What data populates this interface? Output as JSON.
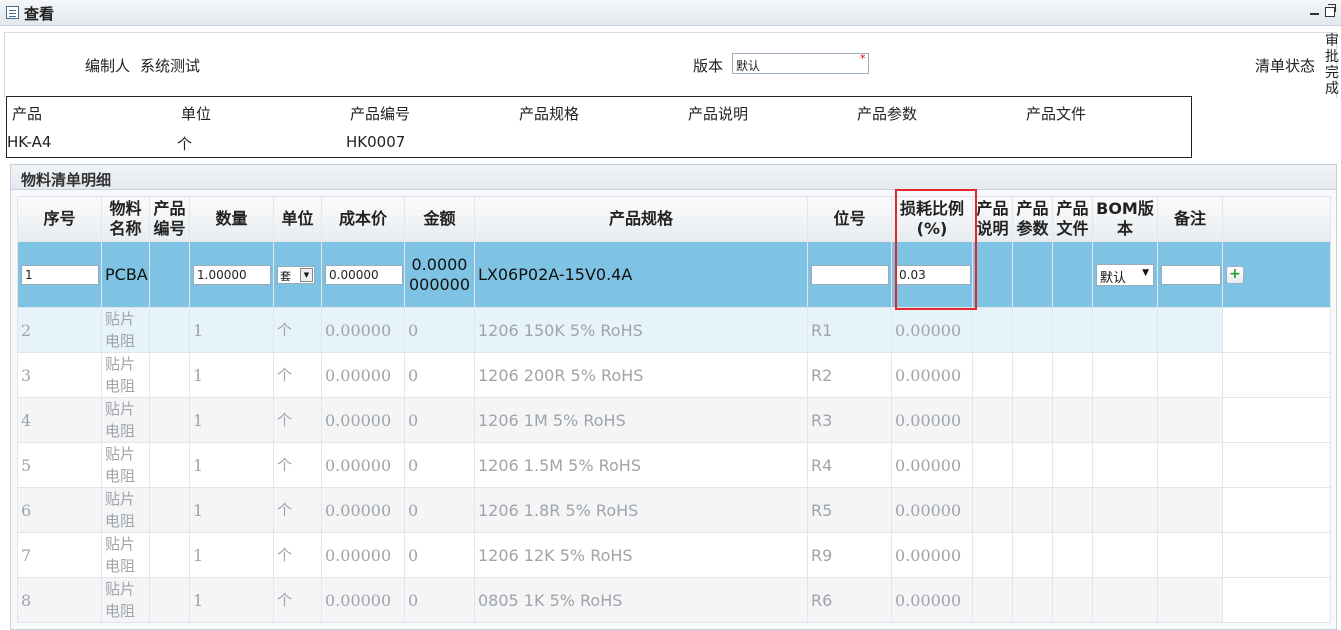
{
  "window": {
    "title": "查看"
  },
  "header": {
    "author_label": "编制人",
    "author_value": "系统测试",
    "version_label": "版本",
    "version_value": "默认",
    "version_required": "*",
    "status_label": "清单状态",
    "status_value": "审批完成"
  },
  "product": {
    "headers": [
      "产品",
      "单位",
      "产品编号",
      "产品规格",
      "产品说明",
      "产品参数",
      "产品文件"
    ],
    "values": [
      "HK-A4",
      "个",
      "HK0007",
      "",
      "",
      "",
      ""
    ]
  },
  "panel": {
    "title": "物料清单明细"
  },
  "grid": {
    "columns": [
      "序号",
      "物料名称",
      "产品编号",
      "数量",
      "单位",
      "成本价",
      "金额",
      "产品规格",
      "位号",
      "损耗比例(%)",
      "产品说明",
      "产品参数",
      "产品文件",
      "BOM版本",
      "备注",
      ""
    ],
    "edit_row": {
      "seq": "1",
      "name": "PCBA",
      "code": "",
      "qty": "1.00000",
      "unit": "套",
      "cost": "0.00000",
      "amount": "0.0000000000",
      "spec": "LX06P02A-15V0.4A",
      "position": "",
      "loss": "0.03",
      "bom": "默认",
      "remark": "",
      "add": "+"
    },
    "rows": [
      {
        "seq": "2",
        "name": "贴片电阻",
        "qty": "1",
        "unit": "个",
        "cost": "0.00000",
        "amount": "0",
        "spec": "1206 150K 5% RoHS",
        "position": "R1",
        "loss": "0.00000"
      },
      {
        "seq": "3",
        "name": "贴片电阻",
        "qty": "1",
        "unit": "个",
        "cost": "0.00000",
        "amount": "0",
        "spec": "1206 200R 5% RoHS",
        "position": "R2",
        "loss": "0.00000"
      },
      {
        "seq": "4",
        "name": "贴片电阻",
        "qty": "1",
        "unit": "个",
        "cost": "0.00000",
        "amount": "0",
        "spec": "1206 1M 5% RoHS",
        "position": "R3",
        "loss": "0.00000"
      },
      {
        "seq": "5",
        "name": "贴片电阻",
        "qty": "1",
        "unit": "个",
        "cost": "0.00000",
        "amount": "0",
        "spec": "1206 1.5M 5% RoHS",
        "position": "R4",
        "loss": "0.00000"
      },
      {
        "seq": "6",
        "name": "贴片电阻",
        "qty": "1",
        "unit": "个",
        "cost": "0.00000",
        "amount": "0",
        "spec": "1206 1.8R 5% RoHS",
        "position": "R5",
        "loss": "0.00000"
      },
      {
        "seq": "7",
        "name": "贴片电阻",
        "qty": "1",
        "unit": "个",
        "cost": "0.00000",
        "amount": "0",
        "spec": "1206 12K 5% RoHS",
        "position": "R9",
        "loss": "0.00000"
      },
      {
        "seq": "8",
        "name": "贴片电阻",
        "qty": "1",
        "unit": "个",
        "cost": "0.00000",
        "amount": "0",
        "spec": "0805 1K 5% RoHS",
        "position": "R6",
        "loss": "0.00000"
      }
    ]
  },
  "colors": {
    "selected_row": "#7ec3e3",
    "highlight_border": "#e0282c",
    "hover_row": "#e7f3fa"
  }
}
